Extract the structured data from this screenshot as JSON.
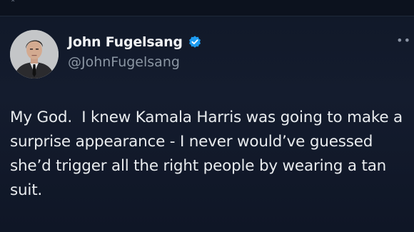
{
  "post": {
    "author": {
      "display_name": "John Fugelsang",
      "handle": "@JohnFugelsang",
      "verified": true,
      "avatar_icon": "profile-photo"
    },
    "text": "My God.  I knew Kamala Harris was going to make a surprise appearance - I never would’ve guessed she’d trigger all the right people by wearing a tan suit."
  },
  "icons": {
    "more": "more-options-icon",
    "verified": "verified-badge-icon"
  },
  "colors": {
    "background": "#15202b",
    "verified_blue": "#1d9bf0",
    "text_primary": "#e7e9ea",
    "text_secondary": "#8b96a3"
  }
}
